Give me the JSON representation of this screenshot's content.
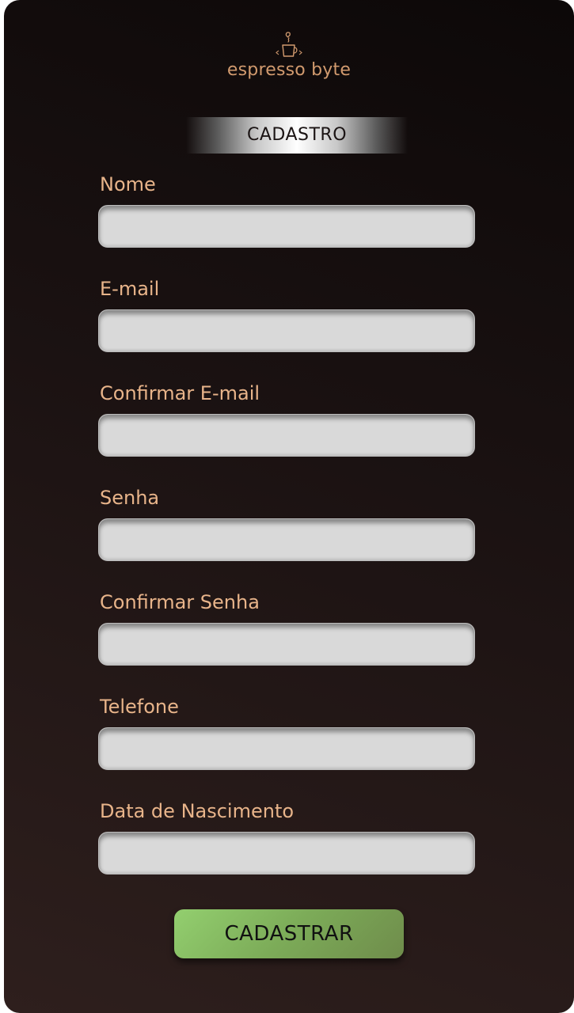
{
  "brand": {
    "logo_icon": "coffee-cup-code-icon",
    "name": "espresso byte",
    "color": "#d19a6e"
  },
  "form": {
    "title": "CADASTRO",
    "fields": [
      {
        "label": "Nome",
        "value": "",
        "placeholder": ""
      },
      {
        "label": "E-mail",
        "value": "",
        "placeholder": ""
      },
      {
        "label": "Confirmar E-mail",
        "value": "",
        "placeholder": ""
      },
      {
        "label": "Senha",
        "value": "",
        "placeholder": ""
      },
      {
        "label": "Confirmar Senha",
        "value": "",
        "placeholder": ""
      },
      {
        "label": "Telefone",
        "value": "",
        "placeholder": ""
      },
      {
        "label": "Data de Nascimento",
        "value": "",
        "placeholder": ""
      }
    ],
    "submit_label": "CADASTRAR"
  },
  "colors": {
    "label": "#e8b48a",
    "input_background": "#d9d9d9",
    "button_green": "#7cab58",
    "background_dark": "#1b1212"
  }
}
